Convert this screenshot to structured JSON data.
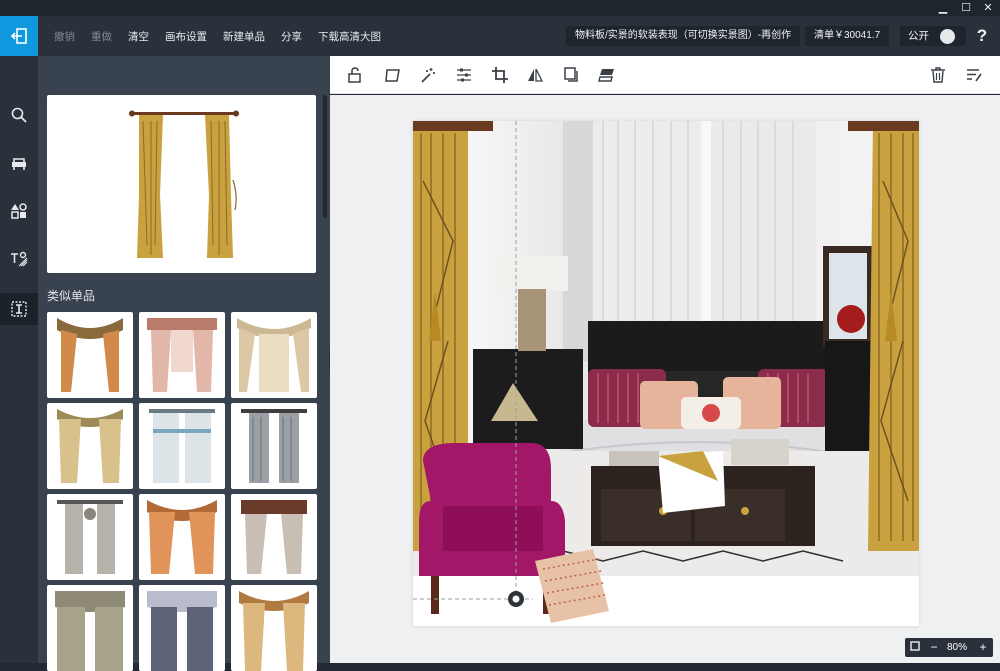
{
  "window": {
    "minimize": "▁",
    "maximize": "☐",
    "close": "✕"
  },
  "menu": {
    "undo": "撤销",
    "redo": "重做",
    "clear": "清空",
    "canvas_settings": "画布设置",
    "new_item": "新建单品",
    "share": "分享",
    "download": "下载高清大图"
  },
  "header": {
    "board_title": "物料板/实景的软装表现（可切换实景图）-再创作",
    "list_total": "清单￥30041.7",
    "public_label": "公开",
    "help": "?"
  },
  "sidebar": {
    "icons": [
      "search-icon",
      "furniture-icon",
      "shapes-icon",
      "text-icon",
      "item-detail-icon"
    ]
  },
  "panel": {
    "similar_title": "类似单品"
  },
  "toolbar": {
    "tools": [
      "unlock-icon",
      "transform-icon",
      "magic-wand-icon",
      "adjust-icon",
      "crop-icon",
      "flip-icon",
      "duplicate-icon",
      "layer-icon"
    ],
    "right_tools": [
      "delete-icon",
      "sort-icon"
    ]
  },
  "zoom": {
    "value": "80%",
    "minus": "−",
    "plus": "+"
  },
  "colors": {
    "accent": "#0f98dd",
    "topbar": "#2a313a",
    "panel": "#394350",
    "curtain_gold": "#c9a23f",
    "chair_magenta": "#a21768"
  }
}
